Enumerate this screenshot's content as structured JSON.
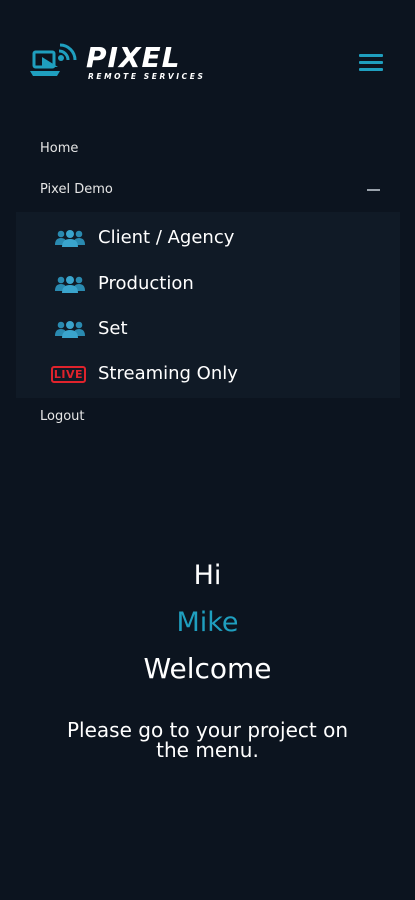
{
  "header": {
    "logo_text": "PIXEL",
    "logo_subtext": "REMOTE SERVICES",
    "menu_icon": "hamburger-icon"
  },
  "menu": {
    "home_label": "Home",
    "group_label": "Pixel Demo",
    "group_state": "expanded",
    "items": [
      {
        "label": "Client / Agency",
        "icon": "users-icon"
      },
      {
        "label": "Production",
        "icon": "users-icon"
      },
      {
        "label": "Set",
        "icon": "users-icon"
      },
      {
        "label": "Streaming Only",
        "icon": "live-icon",
        "badge": "LIVE"
      }
    ],
    "logout_label": "Logout"
  },
  "greeting": {
    "hi": "Hi",
    "name": "Mike",
    "welcome": "Welcome",
    "message": "Please go to your project on the menu."
  },
  "colors": {
    "background": "#0c141f",
    "accent": "#1f9fbf",
    "live_red": "#e0232c",
    "submenu_bg": "#101a26"
  }
}
